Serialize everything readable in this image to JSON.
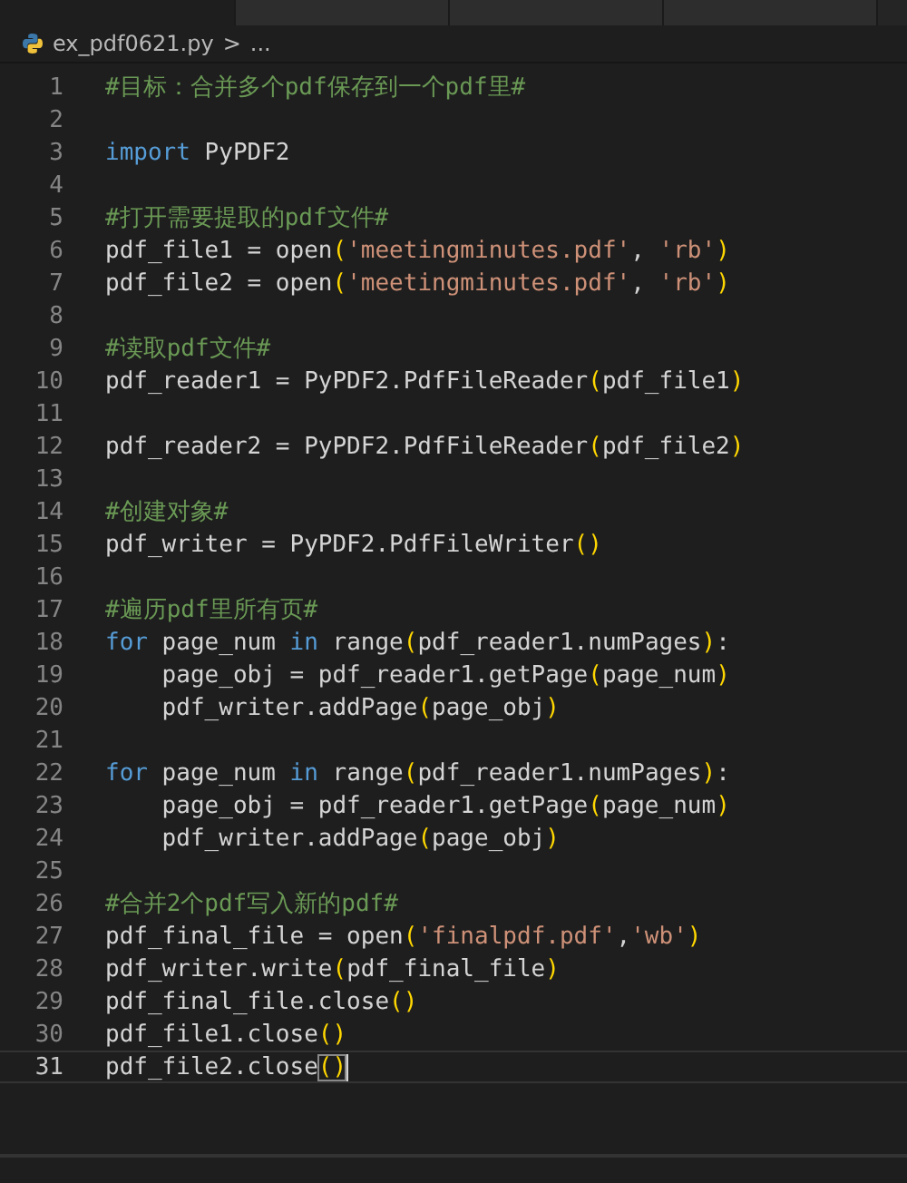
{
  "tabs": [
    {
      "selected": true
    },
    {
      "selected": false
    },
    {
      "selected": false
    },
    {
      "selected": false
    }
  ],
  "breadcrumb": {
    "file": "ex_pdf0621.py",
    "separator": ">",
    "more": "..."
  },
  "lines": [
    {
      "number": "1",
      "current": false,
      "tokens": [
        {
          "text": "#目标：合并多个pdf保存到一个pdf里#",
          "kind": "comment"
        }
      ]
    },
    {
      "number": "2",
      "current": false
    },
    {
      "number": "3",
      "current": false,
      "tokens": [
        {
          "text": "import",
          "kind": "keyword"
        },
        {
          "text": " PyPDF2",
          "kind": "plain"
        }
      ]
    },
    {
      "number": "4",
      "current": false
    },
    {
      "number": "5",
      "current": false,
      "tokens": [
        {
          "text": "#打开需要提取的pdf文件#",
          "kind": "comment"
        }
      ]
    },
    {
      "number": "6",
      "current": false,
      "tokens": [
        {
          "text": "pdf_file1 = open",
          "kind": "plain"
        },
        {
          "text": "(",
          "kind": "paren"
        },
        {
          "text": "'meetingminutes.pdf'",
          "kind": "string"
        },
        {
          "text": ", ",
          "kind": "plain"
        },
        {
          "text": "'rb'",
          "kind": "string"
        },
        {
          "text": ")",
          "kind": "paren"
        }
      ]
    },
    {
      "number": "7",
      "current": false,
      "tokens": [
        {
          "text": "pdf_file2 = open",
          "kind": "plain"
        },
        {
          "text": "(",
          "kind": "paren"
        },
        {
          "text": "'meetingminutes.pdf'",
          "kind": "string"
        },
        {
          "text": ", ",
          "kind": "plain"
        },
        {
          "text": "'rb'",
          "kind": "string"
        },
        {
          "text": ")",
          "kind": "paren"
        }
      ]
    },
    {
      "number": "8",
      "current": false
    },
    {
      "number": "9",
      "current": false,
      "tokens": [
        {
          "text": "#读取pdf文件#",
          "kind": "comment"
        }
      ]
    },
    {
      "number": "10",
      "current": false,
      "tokens": [
        {
          "text": "pdf_reader1 = PyPDF2.PdfFileReader",
          "kind": "plain"
        },
        {
          "text": "(",
          "kind": "paren"
        },
        {
          "text": "pdf_file1",
          "kind": "plain"
        },
        {
          "text": ")",
          "kind": "paren"
        }
      ]
    },
    {
      "number": "11",
      "current": false
    },
    {
      "number": "12",
      "current": false,
      "tokens": [
        {
          "text": "pdf_reader2 = PyPDF2.PdfFileReader",
          "kind": "plain"
        },
        {
          "text": "(",
          "kind": "paren"
        },
        {
          "text": "pdf_file2",
          "kind": "plain"
        },
        {
          "text": ")",
          "kind": "paren"
        }
      ]
    },
    {
      "number": "13",
      "current": false
    },
    {
      "number": "14",
      "current": false,
      "tokens": [
        {
          "text": "#创建对象#",
          "kind": "comment"
        }
      ]
    },
    {
      "number": "15",
      "current": false,
      "tokens": [
        {
          "text": "pdf_writer = PyPDF2.PdfFileWriter",
          "kind": "plain"
        },
        {
          "text": "()",
          "kind": "paren"
        }
      ]
    },
    {
      "number": "16",
      "current": false
    },
    {
      "number": "17",
      "current": false,
      "tokens": [
        {
          "text": "#遍历pdf里所有页#",
          "kind": "comment"
        }
      ]
    },
    {
      "number": "18",
      "current": false,
      "tokens": [
        {
          "text": "for",
          "kind": "keyword"
        },
        {
          "text": " page_num ",
          "kind": "plain"
        },
        {
          "text": "in",
          "kind": "keyword"
        },
        {
          "text": " range",
          "kind": "plain"
        },
        {
          "text": "(",
          "kind": "paren"
        },
        {
          "text": "pdf_reader1.numPages",
          "kind": "plain"
        },
        {
          "text": ")",
          "kind": "paren"
        },
        {
          "text": ":",
          "kind": "plain"
        }
      ]
    },
    {
      "number": "19",
      "current": false,
      "tokens": [
        {
          "text": "    page_obj = pdf_reader1.getPage",
          "kind": "plain"
        },
        {
          "text": "(",
          "kind": "paren"
        },
        {
          "text": "page_num",
          "kind": "plain"
        },
        {
          "text": ")",
          "kind": "paren"
        }
      ]
    },
    {
      "number": "20",
      "current": false,
      "tokens": [
        {
          "text": "    pdf_writer.addPage",
          "kind": "plain"
        },
        {
          "text": "(",
          "kind": "paren"
        },
        {
          "text": "page_obj",
          "kind": "plain"
        },
        {
          "text": ")",
          "kind": "paren"
        }
      ]
    },
    {
      "number": "21",
      "current": false
    },
    {
      "number": "22",
      "current": false,
      "tokens": [
        {
          "text": "for",
          "kind": "keyword"
        },
        {
          "text": " page_num ",
          "kind": "plain"
        },
        {
          "text": "in",
          "kind": "keyword"
        },
        {
          "text": " range",
          "kind": "plain"
        },
        {
          "text": "(",
          "kind": "paren"
        },
        {
          "text": "pdf_reader1.numPages",
          "kind": "plain"
        },
        {
          "text": ")",
          "kind": "paren"
        },
        {
          "text": ":",
          "kind": "plain"
        }
      ]
    },
    {
      "number": "23",
      "current": false,
      "tokens": [
        {
          "text": "    page_obj = pdf_reader1.getPage",
          "kind": "plain"
        },
        {
          "text": "(",
          "kind": "paren"
        },
        {
          "text": "page_num",
          "kind": "plain"
        },
        {
          "text": ")",
          "kind": "paren"
        }
      ]
    },
    {
      "number": "24",
      "current": false,
      "tokens": [
        {
          "text": "    pdf_writer.addPage",
          "kind": "plain"
        },
        {
          "text": "(",
          "kind": "paren"
        },
        {
          "text": "page_obj",
          "kind": "plain"
        },
        {
          "text": ")",
          "kind": "paren"
        }
      ]
    },
    {
      "number": "25",
      "current": false
    },
    {
      "number": "26",
      "current": false,
      "tokens": [
        {
          "text": "#合并2个pdf写入新的pdf#",
          "kind": "comment"
        }
      ]
    },
    {
      "number": "27",
      "current": false,
      "tokens": [
        {
          "text": "pdf_final_file = open",
          "kind": "plain"
        },
        {
          "text": "(",
          "kind": "paren"
        },
        {
          "text": "'finalpdf.pdf'",
          "kind": "string"
        },
        {
          "text": ",",
          "kind": "plain"
        },
        {
          "text": "'wb'",
          "kind": "string"
        },
        {
          "text": ")",
          "kind": "paren"
        }
      ]
    },
    {
      "number": "28",
      "current": false,
      "tokens": [
        {
          "text": "pdf_writer.write",
          "kind": "plain"
        },
        {
          "text": "(",
          "kind": "paren"
        },
        {
          "text": "pdf_final_file",
          "kind": "plain"
        },
        {
          "text": ")",
          "kind": "paren"
        }
      ]
    },
    {
      "number": "29",
      "current": false,
      "tokens": [
        {
          "text": "pdf_final_file.close",
          "kind": "plain"
        },
        {
          "text": "()",
          "kind": "paren"
        }
      ]
    },
    {
      "number": "30",
      "current": false,
      "tokens": [
        {
          "text": "pdf_file1.close",
          "kind": "plain"
        },
        {
          "text": "()",
          "kind": "paren"
        }
      ]
    },
    {
      "number": "31",
      "current": true,
      "tokens": [
        {
          "text": "pdf_file2.close",
          "kind": "plain"
        },
        {
          "text": "()",
          "kind": "paren"
        }
      ]
    }
  ]
}
